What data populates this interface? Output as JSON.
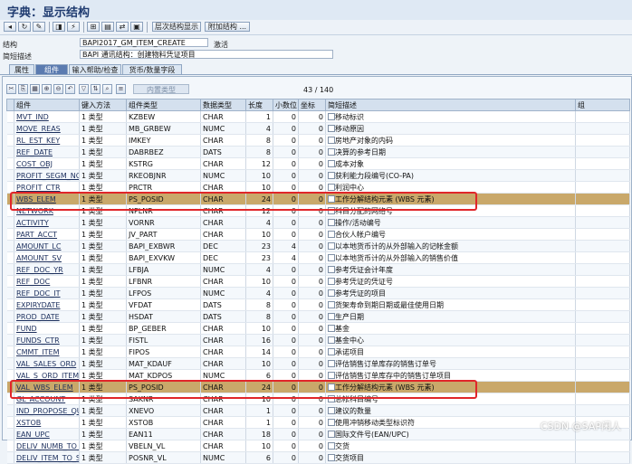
{
  "title": "字典：显示结构",
  "toolbar": {
    "icon_buttons": [
      "back-icon",
      "refresh-icon",
      "tools-icon",
      "display-icon",
      "activate-icon",
      "where-used-icon",
      "object-list-icon",
      "navigate-icon",
      "print-icon",
      "help-icon"
    ],
    "hierarchy_btn": "层次结构显示",
    "append_btn": "附加结构 ..."
  },
  "header": {
    "struct_label": "结构",
    "struct_value": "BAPI2017_GM_ITEM_CREATE",
    "struct_status": "激活",
    "desc_label": "简短描述",
    "desc_value": "BAPI 通讯结构：创建物料凭证项目"
  },
  "tabs": [
    "属性",
    "组件",
    "输入帮助/检查",
    "货币/数量字段"
  ],
  "active_tab": 1,
  "panel": {
    "builtin_label": "内置类型",
    "count": "43  /  140"
  },
  "columns": [
    "组件",
    "键入方法",
    "组件类型",
    "数据类型",
    "长度",
    "小数位",
    "坐标",
    "简短描述",
    "组"
  ],
  "rows": [
    [
      "MVT_IND",
      "1 类型",
      "KZBEW",
      "CHAR",
      "1",
      "0",
      "0",
      "移动标识"
    ],
    [
      "MOVE_REAS",
      "1 类型",
      "MB_GRBEW",
      "NUMC",
      "4",
      "0",
      "0",
      "移动原因"
    ],
    [
      "RL_EST_KEY",
      "1 类型",
      "IMKEY",
      "CHAR",
      "8",
      "0",
      "0",
      "房地产对象的内码"
    ],
    [
      "REF_DATE",
      "1 类型",
      "DABRBEZ",
      "DATS",
      "8",
      "0",
      "0",
      "决算的参考日期"
    ],
    [
      "COST_OBJ",
      "1 类型",
      "KSTRG",
      "CHAR",
      "12",
      "0",
      "0",
      "成本对象"
    ],
    [
      "PROFIT_SEGM_NO",
      "1 类型",
      "RKEOBJNR",
      "NUMC",
      "10",
      "0",
      "0",
      "获利能力段编号(CO-PA)"
    ],
    [
      "PROFIT_CTR",
      "1 类型",
      "PRCTR",
      "CHAR",
      "10",
      "0",
      "0",
      "利润中心"
    ],
    [
      "WBS_ELEM",
      "1 类型",
      "PS_POSID",
      "CHAR",
      "24",
      "0",
      "0",
      "工作分解结构元素 (WBS 元素)"
    ],
    [
      "NETWORK",
      "1 类型",
      "NPLNR",
      "CHAR",
      "12",
      "0",
      "0",
      "科目分配的网络号"
    ],
    [
      "ACTIVITY",
      "1 类型",
      "VORNR",
      "CHAR",
      "4",
      "0",
      "0",
      "操作/活动编号"
    ],
    [
      "PART_ACCT",
      "1 类型",
      "JV_PART",
      "CHAR",
      "10",
      "0",
      "0",
      "合伙人帐户编号"
    ],
    [
      "AMOUNT_LC",
      "1 类型",
      "BAPI_EXBWR",
      "DEC",
      "23",
      "4",
      "0",
      "以本地货币计的从外部输入的记帐金额"
    ],
    [
      "AMOUNT_SV",
      "1 类型",
      "BAPI_EXVKW",
      "DEC",
      "23",
      "4",
      "0",
      "以本地货币计的从外部输入的销售价值"
    ],
    [
      "REF_DOC_YR",
      "1 类型",
      "LFBJA",
      "NUMC",
      "4",
      "0",
      "0",
      "参考凭证会计年度"
    ],
    [
      "REF_DOC",
      "1 类型",
      "LFBNR",
      "CHAR",
      "10",
      "0",
      "0",
      "参考凭证的凭证号"
    ],
    [
      "REF_DOC_IT",
      "1 类型",
      "LFPOS",
      "NUMC",
      "4",
      "0",
      "0",
      "参考凭证的项目"
    ],
    [
      "EXPIRYDATE",
      "1 类型",
      "VFDAT",
      "DATS",
      "8",
      "0",
      "0",
      "货架寿命到期日期或最佳使用日期"
    ],
    [
      "PROD_DATE",
      "1 类型",
      "HSDAT",
      "DATS",
      "8",
      "0",
      "0",
      "生产日期"
    ],
    [
      "FUND",
      "1 类型",
      "BP_GEBER",
      "CHAR",
      "10",
      "0",
      "0",
      "基金"
    ],
    [
      "FUNDS_CTR",
      "1 类型",
      "FISTL",
      "CHAR",
      "16",
      "0",
      "0",
      "基金中心"
    ],
    [
      "CMMT_ITEM",
      "1 类型",
      "FIPOS",
      "CHAR",
      "14",
      "0",
      "0",
      "承诺项目"
    ],
    [
      "VAL_SALES_ORD",
      "1 类型",
      "MAT_KDAUF",
      "CHAR",
      "10",
      "0",
      "0",
      "评估销售订单库存的销售订单号"
    ],
    [
      "VAL_S_ORD_ITEM",
      "1 类型",
      "MAT_KDPOS",
      "NUMC",
      "6",
      "0",
      "0",
      "评估销售订单库存中的销售订单项目"
    ],
    [
      "VAL_WBS_ELEM",
      "1 类型",
      "PS_POSID",
      "CHAR",
      "24",
      "0",
      "0",
      "工作分解结构元素 (WBS 元素)"
    ],
    [
      "GL_ACCOUNT",
      "1 类型",
      "SAKNR",
      "CHAR",
      "10",
      "0",
      "0",
      "总帐科目编号"
    ],
    [
      "IND_PROPOSE_QUA...",
      "1 类型",
      "XNEVO",
      "CHAR",
      "1",
      "0",
      "0",
      "建议的数量"
    ],
    [
      "XSTOB",
      "1 类型",
      "XSTOB",
      "CHAR",
      "1",
      "0",
      "0",
      "使用冲销移动类型标识符"
    ],
    [
      "EAN_UPC",
      "1 类型",
      "EAN11",
      "CHAR",
      "18",
      "0",
      "0",
      "国际文件号(EAN/UPC)"
    ],
    [
      "DELIV_NUMB_TO_S...",
      "1 类型",
      "VBELN_VL",
      "CHAR",
      "10",
      "0",
      "0",
      "交货"
    ],
    [
      "DELIV_ITEM_TO_S...",
      "1 类型",
      "POSNR_VL",
      "NUMC",
      "6",
      "0",
      "0",
      "交货项目"
    ]
  ],
  "highlight_rows": [
    7,
    23
  ],
  "watermark": "CSDN @SAP闲人"
}
